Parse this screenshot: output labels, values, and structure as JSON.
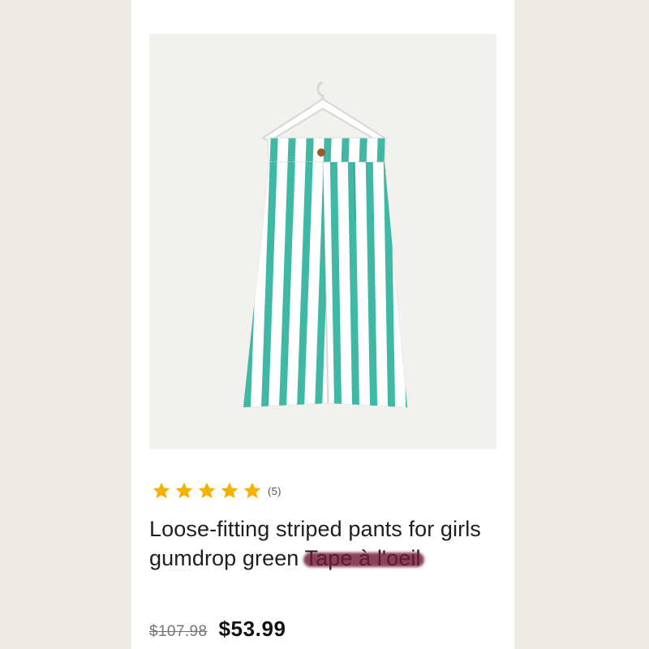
{
  "product": {
    "image_alt": "Striped pants on a hanger",
    "rating": {
      "stars": 5,
      "max_stars": 5,
      "count_label": "(5)",
      "star_color": "#f5b301"
    },
    "title_visible": "Loose-fitting striped pants for girls gumdrop green ",
    "title_redacted": "Tape à l'oeil",
    "price": {
      "old": "$107.98",
      "new": "$53.99"
    },
    "stripe_color": "#3fb8a6"
  }
}
